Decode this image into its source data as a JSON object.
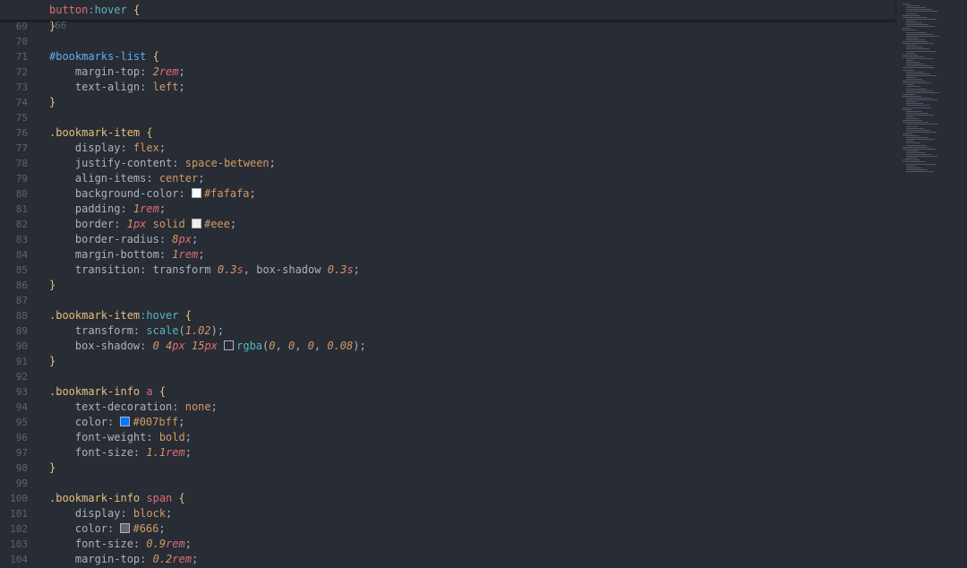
{
  "sticky_line": {
    "number": "66",
    "tokens": [
      {
        "t": "button",
        "c": "t-tag"
      },
      {
        "t": ":hover",
        "c": "t-pseudo"
      },
      {
        "t": " {",
        "c": "t-brace"
      }
    ]
  },
  "lines": [
    {
      "n": "69",
      "tokens": [
        {
          "t": "}",
          "c": "t-brace"
        }
      ]
    },
    {
      "n": "70",
      "tokens": []
    },
    {
      "n": "71",
      "tokens": [
        {
          "t": "#bookmarks-list",
          "c": "t-id"
        },
        {
          "t": " {",
          "c": "t-brace"
        }
      ]
    },
    {
      "n": "72",
      "tokens": [
        {
          "t": "    margin-top: ",
          "c": "t-prop"
        },
        {
          "t": "2",
          "c": "t-num"
        },
        {
          "t": "rem",
          "c": "t-unit"
        },
        {
          "t": ";",
          "c": "t-punc"
        }
      ]
    },
    {
      "n": "73",
      "tokens": [
        {
          "t": "    text-align: ",
          "c": "t-prop"
        },
        {
          "t": "left",
          "c": "t-val"
        },
        {
          "t": ";",
          "c": "t-punc"
        }
      ]
    },
    {
      "n": "74",
      "tokens": [
        {
          "t": "}",
          "c": "t-brace"
        }
      ]
    },
    {
      "n": "75",
      "tokens": []
    },
    {
      "n": "76",
      "tokens": [
        {
          "t": ".bookmark-item",
          "c": "t-cls"
        },
        {
          "t": " {",
          "c": "t-brace"
        }
      ]
    },
    {
      "n": "77",
      "tokens": [
        {
          "t": "    display: ",
          "c": "t-prop"
        },
        {
          "t": "flex",
          "c": "t-val"
        },
        {
          "t": ";",
          "c": "t-punc"
        }
      ]
    },
    {
      "n": "78",
      "tokens": [
        {
          "t": "    justify-content: ",
          "c": "t-prop"
        },
        {
          "t": "space-between",
          "c": "t-val"
        },
        {
          "t": ";",
          "c": "t-punc"
        }
      ]
    },
    {
      "n": "79",
      "tokens": [
        {
          "t": "    align-items: ",
          "c": "t-prop"
        },
        {
          "t": "center",
          "c": "t-val"
        },
        {
          "t": ";",
          "c": "t-punc"
        }
      ]
    },
    {
      "n": "80",
      "tokens": [
        {
          "t": "    background-color: ",
          "c": "t-prop"
        },
        {
          "swatch": "#fafafa"
        },
        {
          "t": "#fafafa",
          "c": "t-hex"
        },
        {
          "t": ";",
          "c": "t-punc"
        }
      ]
    },
    {
      "n": "81",
      "tokens": [
        {
          "t": "    padding: ",
          "c": "t-prop"
        },
        {
          "t": "1",
          "c": "t-num"
        },
        {
          "t": "rem",
          "c": "t-unit"
        },
        {
          "t": ";",
          "c": "t-punc"
        }
      ]
    },
    {
      "n": "82",
      "tokens": [
        {
          "t": "    border: ",
          "c": "t-prop"
        },
        {
          "t": "1",
          "c": "t-num"
        },
        {
          "t": "px",
          "c": "t-unit"
        },
        {
          "t": " solid ",
          "c": "t-val"
        },
        {
          "swatch": "#eeeeee"
        },
        {
          "t": "#eee",
          "c": "t-hex"
        },
        {
          "t": ";",
          "c": "t-punc"
        }
      ]
    },
    {
      "n": "83",
      "tokens": [
        {
          "t": "    border-radius: ",
          "c": "t-prop"
        },
        {
          "t": "8",
          "c": "t-num"
        },
        {
          "t": "px",
          "c": "t-unit"
        },
        {
          "t": ";",
          "c": "t-punc"
        }
      ]
    },
    {
      "n": "84",
      "tokens": [
        {
          "t": "    margin-bottom: ",
          "c": "t-prop"
        },
        {
          "t": "1",
          "c": "t-num"
        },
        {
          "t": "rem",
          "c": "t-unit"
        },
        {
          "t": ";",
          "c": "t-punc"
        }
      ]
    },
    {
      "n": "85",
      "tokens": [
        {
          "t": "    transition: ",
          "c": "t-prop"
        },
        {
          "t": "transform ",
          "c": "t-prop"
        },
        {
          "t": "0.3",
          "c": "t-num"
        },
        {
          "t": "s",
          "c": "t-unit"
        },
        {
          "t": ", box-shadow ",
          "c": "t-prop"
        },
        {
          "t": "0.3",
          "c": "t-num"
        },
        {
          "t": "s",
          "c": "t-unit"
        },
        {
          "t": ";",
          "c": "t-punc"
        }
      ]
    },
    {
      "n": "86",
      "tokens": [
        {
          "t": "}",
          "c": "t-brace"
        }
      ]
    },
    {
      "n": "87",
      "tokens": []
    },
    {
      "n": "88",
      "tokens": [
        {
          "t": ".bookmark-item",
          "c": "t-cls"
        },
        {
          "t": ":hover",
          "c": "t-pseudo"
        },
        {
          "t": " {",
          "c": "t-brace"
        }
      ]
    },
    {
      "n": "89",
      "tokens": [
        {
          "t": "    transform: ",
          "c": "t-prop"
        },
        {
          "t": "scale",
          "c": "t-fn"
        },
        {
          "t": "(",
          "c": "t-punc"
        },
        {
          "t": "1.02",
          "c": "t-num"
        },
        {
          "t": ");",
          "c": "t-punc"
        }
      ]
    },
    {
      "n": "90",
      "tokens": [
        {
          "t": "    box-shadow: ",
          "c": "t-prop"
        },
        {
          "t": "0",
          "c": "t-num"
        },
        {
          "t": " ",
          "c": "t-punc"
        },
        {
          "t": "4",
          "c": "t-num"
        },
        {
          "t": "px",
          "c": "t-unit"
        },
        {
          "t": " ",
          "c": "t-punc"
        },
        {
          "t": "15",
          "c": "t-num"
        },
        {
          "t": "px",
          "c": "t-unit"
        },
        {
          "t": " ",
          "c": "t-punc"
        },
        {
          "swatch": "transparent"
        },
        {
          "t": "rgba",
          "c": "t-fn"
        },
        {
          "t": "(",
          "c": "t-punc"
        },
        {
          "t": "0",
          "c": "t-num"
        },
        {
          "t": ", ",
          "c": "t-punc"
        },
        {
          "t": "0",
          "c": "t-num"
        },
        {
          "t": ", ",
          "c": "t-punc"
        },
        {
          "t": "0",
          "c": "t-num"
        },
        {
          "t": ", ",
          "c": "t-punc"
        },
        {
          "t": "0.08",
          "c": "t-num"
        },
        {
          "t": ");",
          "c": "t-punc"
        }
      ]
    },
    {
      "n": "91",
      "tokens": [
        {
          "t": "}",
          "c": "t-brace"
        }
      ]
    },
    {
      "n": "92",
      "tokens": []
    },
    {
      "n": "93",
      "tokens": [
        {
          "t": ".bookmark-info",
          "c": "t-cls"
        },
        {
          "t": " a",
          "c": "t-tag"
        },
        {
          "t": " {",
          "c": "t-brace"
        }
      ]
    },
    {
      "n": "94",
      "tokens": [
        {
          "t": "    text-decoration: ",
          "c": "t-prop"
        },
        {
          "t": "none",
          "c": "t-val"
        },
        {
          "t": ";",
          "c": "t-punc"
        }
      ]
    },
    {
      "n": "95",
      "tokens": [
        {
          "t": "    color: ",
          "c": "t-prop"
        },
        {
          "swatch": "#007bff"
        },
        {
          "t": "#007bff",
          "c": "t-hex"
        },
        {
          "t": ";",
          "c": "t-punc"
        }
      ]
    },
    {
      "n": "96",
      "tokens": [
        {
          "t": "    font-weight: ",
          "c": "t-prop"
        },
        {
          "t": "bold",
          "c": "t-val"
        },
        {
          "t": ";",
          "c": "t-punc"
        }
      ]
    },
    {
      "n": "97",
      "tokens": [
        {
          "t": "    font-size: ",
          "c": "t-prop"
        },
        {
          "t": "1.1",
          "c": "t-num"
        },
        {
          "t": "rem",
          "c": "t-unit"
        },
        {
          "t": ";",
          "c": "t-punc"
        }
      ]
    },
    {
      "n": "98",
      "tokens": [
        {
          "t": "}",
          "c": "t-brace"
        }
      ]
    },
    {
      "n": "99",
      "tokens": []
    },
    {
      "n": "100",
      "tokens": [
        {
          "t": ".bookmark-info",
          "c": "t-cls"
        },
        {
          "t": " span",
          "c": "t-tag"
        },
        {
          "t": " {",
          "c": "t-brace"
        }
      ]
    },
    {
      "n": "101",
      "tokens": [
        {
          "t": "    display: ",
          "c": "t-prop"
        },
        {
          "t": "block",
          "c": "t-val"
        },
        {
          "t": ";",
          "c": "t-punc"
        }
      ]
    },
    {
      "n": "102",
      "tokens": [
        {
          "t": "    color: ",
          "c": "t-prop"
        },
        {
          "swatch": "#666666"
        },
        {
          "t": "#666",
          "c": "t-hex"
        },
        {
          "t": ";",
          "c": "t-punc"
        }
      ]
    },
    {
      "n": "103",
      "tokens": [
        {
          "t": "    font-size: ",
          "c": "t-prop"
        },
        {
          "t": "0.9",
          "c": "t-num"
        },
        {
          "t": "rem",
          "c": "t-unit"
        },
        {
          "t": ";",
          "c": "t-punc"
        }
      ]
    },
    {
      "n": "104",
      "tokens": [
        {
          "t": "    margin-top: ",
          "c": "t-prop"
        },
        {
          "t": "0.2",
          "c": "t-num"
        },
        {
          "t": "rem",
          "c": "t-unit"
        },
        {
          "t": ";",
          "c": "t-punc"
        }
      ]
    }
  ],
  "colors": {
    "background": "#282c34",
    "gutter": "#5c6370"
  }
}
